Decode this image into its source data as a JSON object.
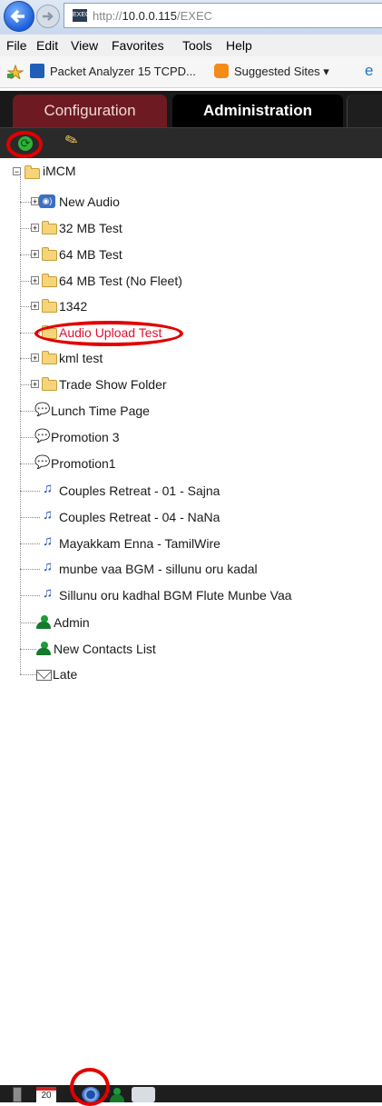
{
  "browser": {
    "url_prefix": "http://",
    "url_host": "10.0.0.115",
    "url_path": "/EXEC",
    "favicon_text": "EXEC",
    "menu": [
      "File",
      "Edit",
      "View",
      "Favorites",
      "Tools",
      "Help"
    ],
    "favorites": {
      "packet_analyzer": "Packet Analyzer 15 TCPD...",
      "suggested_sites": "Suggested Sites ▾"
    }
  },
  "app": {
    "tabs": {
      "configuration": "Configuration",
      "administration": "Administration"
    },
    "tree": {
      "root": "iMCM",
      "items": [
        {
          "label": "New Audio",
          "icon": "audio-folder-icon"
        },
        {
          "label": "32 MB Test",
          "icon": "folder-icon"
        },
        {
          "label": "64 MB Test",
          "icon": "folder-icon"
        },
        {
          "label": "64 MB Test (No Fleet)",
          "icon": "folder-icon"
        },
        {
          "label": "1342",
          "icon": "folder-icon"
        },
        {
          "label": "Audio Upload Test",
          "icon": "folder-icon",
          "color": "#e0102f"
        },
        {
          "label": "kml test",
          "icon": "folder-icon"
        },
        {
          "label": "Trade Show Folder",
          "icon": "folder-icon"
        },
        {
          "label": "Lunch Time Page",
          "icon": "page-icon"
        },
        {
          "label": "Promotion 3",
          "icon": "page-icon"
        },
        {
          "label": "Promotion1",
          "icon": "page-icon"
        },
        {
          "label": "Couples Retreat - 01 - Sajna",
          "icon": "music-note-icon"
        },
        {
          "label": "Couples Retreat - 04 - NaNa",
          "icon": "music-note-icon"
        },
        {
          "label": "Mayakkam Enna - TamilWire",
          "icon": "music-note-icon"
        },
        {
          "label": "munbe vaa BGM - sillunu oru kadal",
          "icon": "music-note-icon"
        },
        {
          "label": "Sillunu oru kadhal BGM Flute Munbe Vaa",
          "icon": "music-note-icon"
        },
        {
          "label": "Admin",
          "icon": "contact-icon"
        },
        {
          "label": "New Contacts List",
          "icon": "contact-icon"
        },
        {
          "label": "Late",
          "icon": "envelope-icon"
        }
      ]
    },
    "colors": {
      "highlight_ring": "#e20000",
      "config_tab": "#6d1a22",
      "selected_item": "#e0102f"
    },
    "bottom_icons": [
      "device-icon",
      "calendar-icon",
      "speaker-icon",
      "contact-icon",
      "message-icon"
    ],
    "calendar_day": "20"
  }
}
